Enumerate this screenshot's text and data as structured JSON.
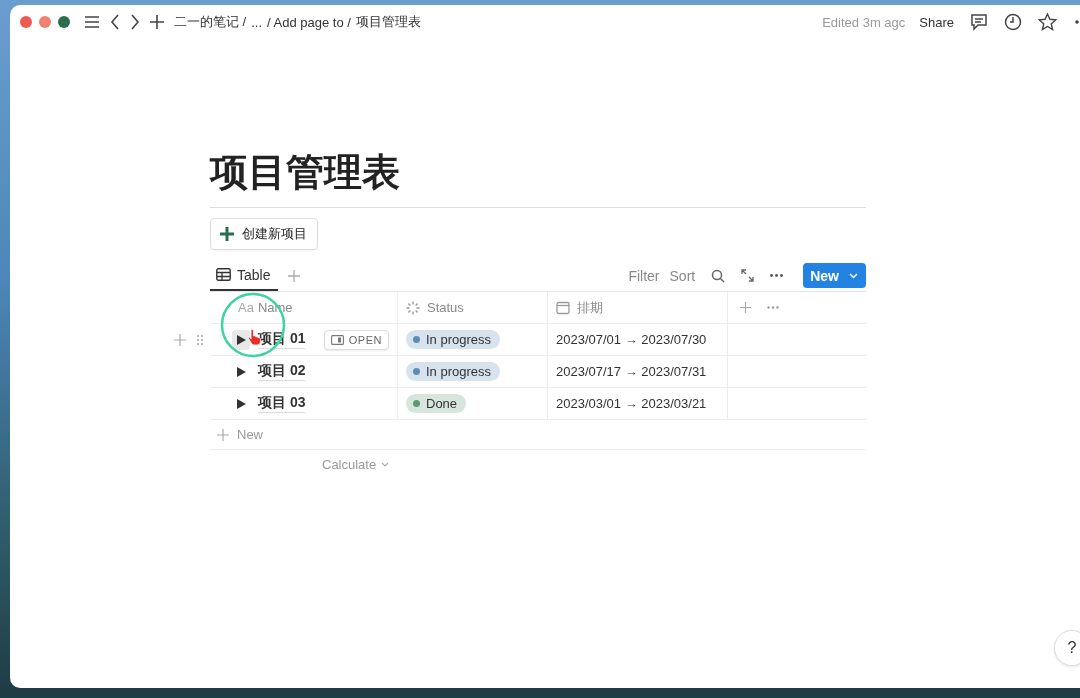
{
  "topbar": {
    "breadcrumbs": [
      "二一的笔记 /",
      "...",
      "/ Add page to /",
      "项目管理表"
    ],
    "edited": "Edited 3m agc",
    "share": "Share"
  },
  "page": {
    "title": "项目管理表",
    "action_button": "创建新项目"
  },
  "view": {
    "tabs": [
      {
        "label": "Table",
        "selected": true
      }
    ],
    "tools": [
      "Filter",
      "Sort"
    ],
    "new_button": "New"
  },
  "table": {
    "columns": [
      {
        "prefix": "Aa",
        "label": "Name",
        "kind": "title"
      },
      {
        "label": "Status",
        "kind": "status"
      },
      {
        "label": "排期",
        "kind": "date"
      }
    ],
    "rows": [
      {
        "name": "项目 01",
        "hovered": true,
        "open_button": "OPEN",
        "status": "In progress",
        "color": "#5b8db8",
        "dates": "2023/07/01 → 2023/07/30"
      },
      {
        "name": "项目 02",
        "hovered": false,
        "status": "In progress",
        "color": "#5b8db8",
        "dates": "2023/07/17 → 2023/07/31"
      },
      {
        "name": "项目 03",
        "hovered": false,
        "status": "Done",
        "color": "#5e9a72",
        "dates": "2023/03/01 → 2023/03/21"
      }
    ],
    "new_row": "New",
    "calculate": "Calculate"
  },
  "help": "?"
}
